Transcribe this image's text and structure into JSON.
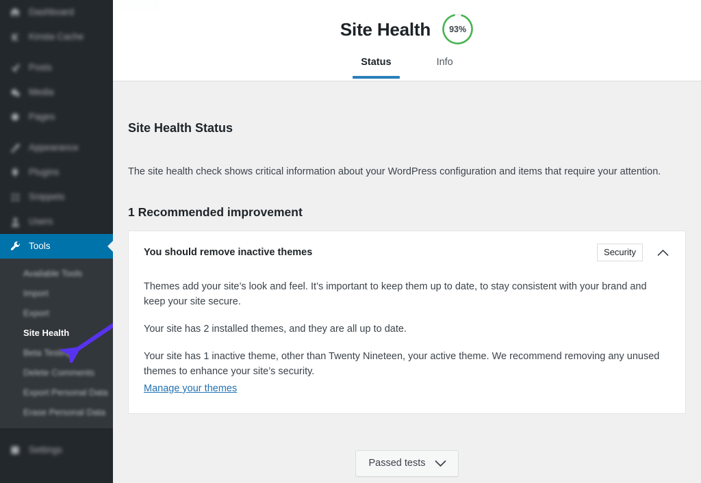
{
  "sidebar": {
    "items": [
      {
        "label": "Dashboard",
        "icon": "dashboard-icon",
        "blurred": true
      },
      {
        "label": "Kinsta Cache",
        "icon": "kinsta-icon",
        "blurred": true
      },
      {
        "label": "Posts",
        "icon": "pin-icon",
        "blurred": true
      },
      {
        "label": "Media",
        "icon": "media-icon",
        "blurred": true
      },
      {
        "label": "Pages",
        "icon": "page-icon",
        "blurred": true
      },
      {
        "label": "Appearance",
        "icon": "brush-icon",
        "blurred": true
      },
      {
        "label": "Plugins",
        "icon": "plugin-icon",
        "blurred": true
      },
      {
        "label": "Snippets",
        "icon": "snippets-icon",
        "blurred": true
      },
      {
        "label": "Users",
        "icon": "users-icon",
        "blurred": true
      },
      {
        "label": "Tools",
        "icon": "wrench-icon",
        "blurred": false,
        "current": true
      }
    ],
    "submenu": [
      {
        "label": "Available Tools",
        "active": false
      },
      {
        "label": "Import",
        "active": false
      },
      {
        "label": "Export",
        "active": false
      },
      {
        "label": "Site Health",
        "active": true
      },
      {
        "label": "Beta Testing",
        "active": false
      },
      {
        "label": "Delete Comments",
        "active": false
      },
      {
        "label": "Export Personal Data",
        "active": false
      },
      {
        "label": "Erase Personal Data",
        "active": false
      }
    ],
    "bottom_items": [
      {
        "label": "Settings",
        "icon": "settings-icon",
        "blurred": true
      }
    ],
    "active_color": "#0073aa",
    "background": "#23282d",
    "submenu_background": "#32373c"
  },
  "annotation": {
    "arrow_color": "#5833ef",
    "points_to": "Site Health"
  },
  "header": {
    "watermark": "Kinsta",
    "title": "Site Health",
    "health_percent": "93%",
    "health_value": 93,
    "gauge_color": "#46b450",
    "tabs": [
      {
        "label": "Status",
        "active": true
      },
      {
        "label": "Info",
        "active": false
      }
    ]
  },
  "main": {
    "section_title": "Site Health Status",
    "section_description": "The site health check shows critical information about your WordPress configuration and items that require your attention.",
    "improvement_count_label": "1 Recommended improvement",
    "issue": {
      "title": "You should remove inactive themes",
      "badge": "Security",
      "toggle_icon": "chevron-up-icon",
      "paragraphs": [
        "Themes add your site’s look and feel. It’s important to keep them up to date, to stay consistent with your brand and keep your site secure.",
        "Your site has 2 installed themes, and they are all up to date.",
        "Your site has 1 inactive theme, other than Twenty Nineteen, your active theme. We recommend removing any unused themes to enhance your site’s security."
      ],
      "link_label": "Manage your themes"
    },
    "passed_tests_button": {
      "label": "Passed tests",
      "icon": "chevron-down-icon"
    }
  }
}
